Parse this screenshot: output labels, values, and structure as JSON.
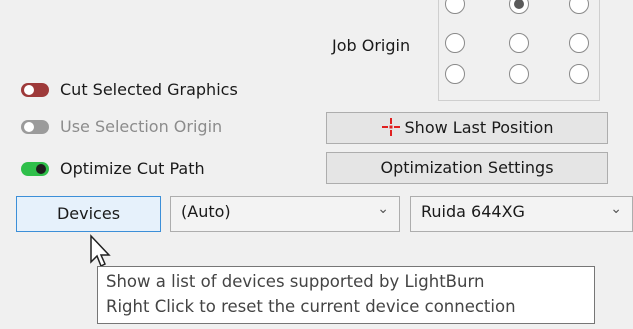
{
  "job_origin": {
    "label": "Job Origin",
    "radios": [
      {
        "row": 0,
        "col": 0,
        "checked": false
      },
      {
        "row": 0,
        "col": 1,
        "checked": true
      },
      {
        "row": 0,
        "col": 2,
        "checked": false
      },
      {
        "row": 1,
        "col": 0,
        "checked": false
      },
      {
        "row": 1,
        "col": 1,
        "checked": false
      },
      {
        "row": 1,
        "col": 2,
        "checked": false
      },
      {
        "row": 2,
        "col": 0,
        "checked": false
      },
      {
        "row": 2,
        "col": 1,
        "checked": false
      },
      {
        "row": 2,
        "col": 2,
        "checked": false
      }
    ]
  },
  "options": {
    "cut_selected": {
      "label": "Cut Selected Graphics",
      "state": "off",
      "color": "#9e3a3a"
    },
    "use_selection_origin": {
      "label": "Use Selection Origin",
      "state": "off",
      "disabled": true
    },
    "optimize_cut_path": {
      "label": "Optimize Cut Path",
      "state": "on",
      "color": "#2fbf4a"
    }
  },
  "buttons": {
    "show_last_position": "Show Last Position",
    "optimization_settings": "Optimization Settings",
    "devices": "Devices"
  },
  "selects": {
    "port": {
      "value": "(Auto)"
    },
    "device": {
      "value": "Ruida 644XG"
    }
  },
  "tooltip": {
    "line1": "Show a list of devices supported by LightBurn",
    "line2": "Right Click to reset the current device connection"
  },
  "icons": {
    "crosshair": "red-crosshair-icon",
    "chevron": "chevron-down-icon",
    "cursor": "mouse-pointer-icon"
  }
}
